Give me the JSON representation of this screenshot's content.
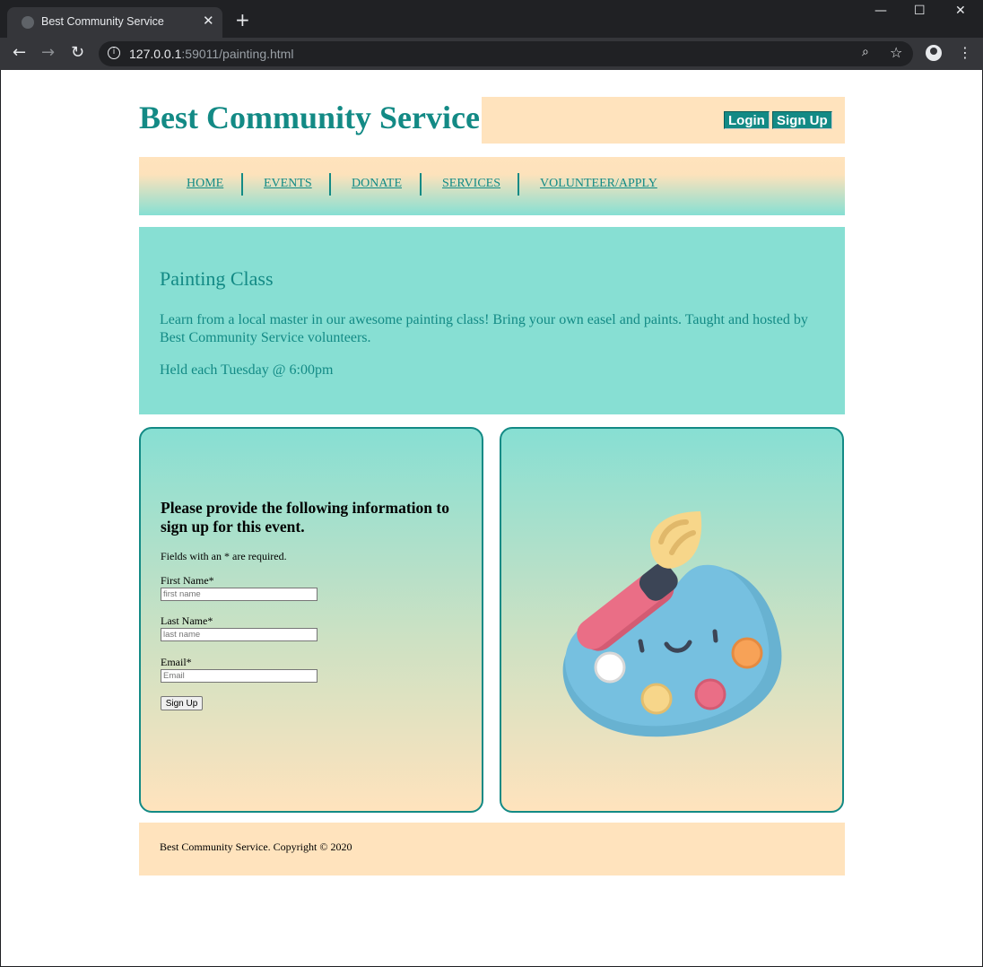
{
  "browser": {
    "tab_title": "Best Community Service",
    "tab_close": "✕",
    "new_tab": "+",
    "url_host": "127.0.0.1",
    "url_rest": ":59011/painting.html",
    "minimize": "—",
    "maximize": "☐",
    "close": "✕"
  },
  "header": {
    "site_title": "Best Community Service",
    "login_label": "Login",
    "signup_label": "Sign Up"
  },
  "nav": {
    "items": [
      {
        "label": "HOME"
      },
      {
        "label": "EVENTS"
      },
      {
        "label": "DONATE"
      },
      {
        "label": "SERVICES"
      },
      {
        "label": "VOLUNTEER/APPLY"
      }
    ]
  },
  "event": {
    "title": "Painting Class",
    "description": "Learn from a local master in our awesome painting class! Bring your own easel and paints. Taught and hosted by Best Community Service volunteers.",
    "schedule": "Held each Tuesday @ 6:00pm"
  },
  "form": {
    "heading": "Please provide the following information to sign up for this event.",
    "required_note": "Fields with an * are required.",
    "first_name_label": "First Name*",
    "first_name_placeholder": "first name",
    "last_name_label": "Last Name*",
    "last_name_placeholder": "last name",
    "email_label": "Email*",
    "email_placeholder": "Email",
    "submit_label": "Sign Up"
  },
  "footer": {
    "text": "Best Community Service. Copyright © 2020"
  },
  "colors": {
    "teal": "#138a85",
    "mint": "#87dfd3",
    "peach": "#ffe3bd"
  }
}
